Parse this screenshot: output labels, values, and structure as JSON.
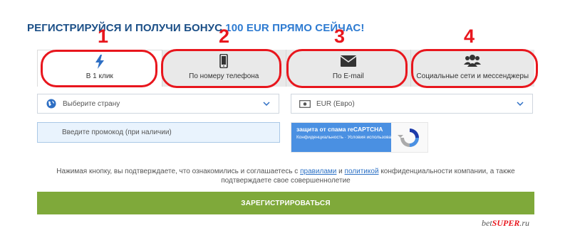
{
  "headline": {
    "part1": "РЕГИСТРИРУЙСЯ И ПОЛУЧИ БОНУС",
    "part2": "100 EUR",
    "part3": "ПРЯМО СЕЙЧАС!"
  },
  "annotations": [
    "1",
    "2",
    "3",
    "4"
  ],
  "tabs": [
    {
      "label": "В 1 клик",
      "icon": "lightning-icon",
      "active": true
    },
    {
      "label": "По номеру телефона",
      "icon": "smartphone-icon",
      "active": false
    },
    {
      "label": "По E-mail",
      "icon": "envelope-icon",
      "active": false
    },
    {
      "label": "Социальные сети и мессенджеры",
      "icon": "users-icon",
      "active": false
    }
  ],
  "country_select": {
    "value": "Выберите страну",
    "icon": "globe-icon"
  },
  "currency_select": {
    "value": "EUR (Евро)",
    "icon": "banknote-icon"
  },
  "promo": {
    "placeholder": "Введите промокод (при наличии)"
  },
  "captcha": {
    "title": "защита от спама reCAPTCHA",
    "links": "Конфиденциальность · Условия использования",
    "icon": "recaptcha-icon"
  },
  "terms": {
    "prefix": "Нажимая кнопку, вы подтверждаете, что ознакомились и соглашаетесь с",
    "rules_link": "правилами",
    "and": "и",
    "policy_link": "политикой",
    "suffix": "конфиденциальности компании, а также подтверждаете свое совершеннолетие"
  },
  "register_button": "ЗАРЕГИСТРИРОВАТЬСЯ",
  "watermark": {
    "a": "bet",
    "b": "SUPER",
    "c": ".ru"
  },
  "colors": {
    "accent": "#2e7bd1",
    "heading": "#1b4f87",
    "button": "#7fa93a",
    "annotation": "#e8161d"
  }
}
